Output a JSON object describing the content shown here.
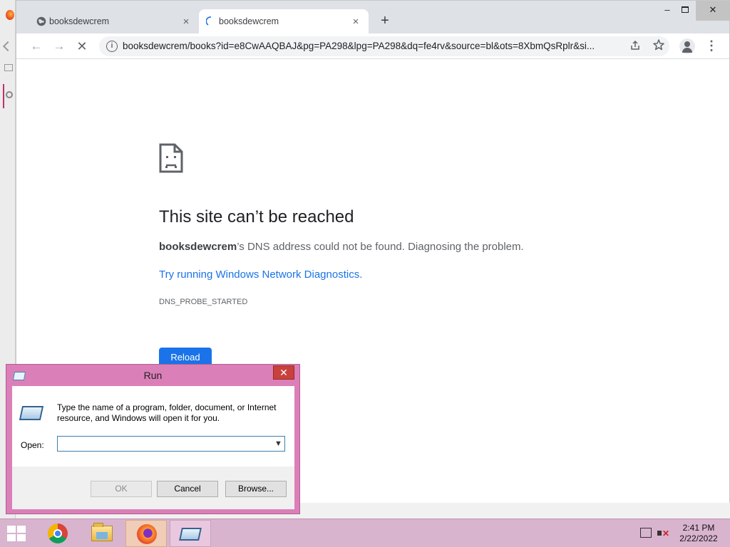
{
  "browser": {
    "tabs": [
      {
        "title": "booksdewcrem",
        "close": "×"
      },
      {
        "title": "booksdewcrem",
        "close": "×"
      }
    ],
    "new_tab": "+",
    "window_controls": {
      "minimize": "–",
      "close": "✕"
    },
    "nav": {
      "back": "←",
      "forward": "→",
      "stop": "✕"
    },
    "omnibox": {
      "info_glyph": "i",
      "url": "booksdewcrem/books?id=e8CwAAQBAJ&pg=PA298&lpg=PA298&dq=fe4rv&source=bl&ots=8XbmQsRplr&si..."
    },
    "menu_glyph": "⋮"
  },
  "error_page": {
    "title": "This site can’t be reached",
    "host": "booksdewcrem",
    "desc_rest": "’s DNS address could not be found. Diagnosing the problem.",
    "link": "Try running Windows Network Diagnostics.",
    "code": "DNS_PROBE_STARTED",
    "reload": "Reload"
  },
  "run_dialog": {
    "title": "Run",
    "close": "✕",
    "message": "Type the name of a program, folder, document, or Internet resource, and Windows will open it for you.",
    "open_label": "Open:",
    "open_value": "",
    "ok": "OK",
    "cancel": "Cancel",
    "browse": "Browse..."
  },
  "taskbar": {
    "time": "2:41 PM",
    "date": "2/22/2022"
  }
}
